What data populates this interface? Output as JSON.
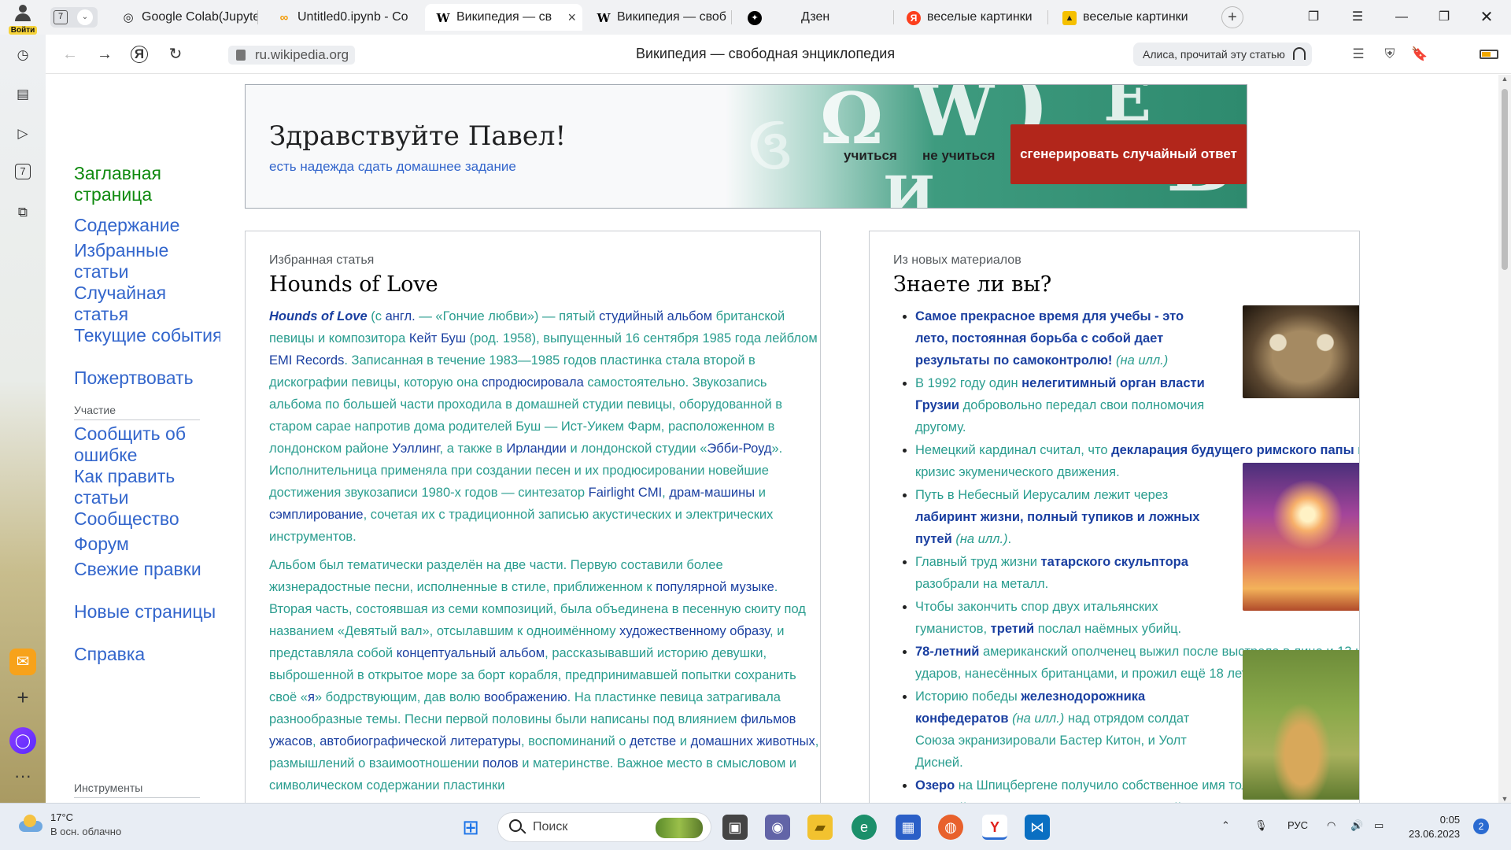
{
  "tabbar": {
    "profile_label": "Войти",
    "tab_count": "7",
    "tabs": [
      {
        "title": "Google Colab(Jupyter",
        "icon": "◎"
      },
      {
        "title": "Untitled0.ipynb - Co",
        "icon": "∞"
      },
      {
        "title": "Википедия — св",
        "icon": "W"
      },
      {
        "title": "Википедия — своб",
        "icon": "W"
      },
      {
        "title": "Дзен",
        "icon": "✦"
      },
      {
        "title": "веселые картинки",
        "icon": "Я"
      },
      {
        "title": "веселые картинки",
        "icon": "▲"
      }
    ],
    "active_close": "×"
  },
  "addressbar": {
    "url": "ru.wikipedia.org",
    "page_title": "Википедия — свободная энциклопедия",
    "alice_label": "Алиса, прочитай эту статью"
  },
  "wiki_nav": {
    "main_page": "Заглавная страница",
    "links": [
      "Содержание",
      "Избранные статьи",
      "Случайная статья",
      "Текущие события",
      "Пожертвовать"
    ],
    "participation_heading": "Участие",
    "participation_links": [
      "Сообщить об ошибке",
      "Как править статьи",
      "Сообщество",
      "Форум",
      "Свежие правки",
      "Новые страницы",
      "Справка"
    ],
    "tools_heading": "Инструменты"
  },
  "banner": {
    "greeting": "Здравствуйте Павел!",
    "subtitle": "есть надежда сдать домашнее задание",
    "btn_study": "учиться",
    "btn_nostudy": "не учиться",
    "btn_generate": "сгенерировать случайный ответ"
  },
  "featured": {
    "label": "Избранная статья",
    "title": "Hounds of Love",
    "p1": [
      {
        "t": "Hounds of Love",
        "s": "bi"
      },
      {
        "t": " (с ",
        "s": ""
      },
      {
        "t": "англ.",
        "s": "l"
      },
      {
        "t": " — «Гончие любви») — пятый ",
        "s": ""
      },
      {
        "t": "студийный альбом",
        "s": "l"
      },
      {
        "t": " британской певицы и композитора ",
        "s": ""
      },
      {
        "t": "Кейт Буш",
        "s": "l"
      },
      {
        "t": " (род. 1958), выпущенный 16 сентября 1985 года лейблом ",
        "s": ""
      },
      {
        "t": "EMI Records",
        "s": "l"
      },
      {
        "t": ". Записанная в течение 1983—1985 годов пластинка стала второй в дискографии певицы, которую она ",
        "s": ""
      },
      {
        "t": "спродюсировала",
        "s": "l"
      },
      {
        "t": " самостоятельно. Звукозапись альбома по большей части проходила в домашней студии певицы, оборудованной в старом сарае напротив дома родителей Буш — Ист-Уикем Фарм, расположенном в лондонском районе ",
        "s": ""
      },
      {
        "t": "Уэллинг",
        "s": "l"
      },
      {
        "t": ", а также в ",
        "s": ""
      },
      {
        "t": "Ирландии",
        "s": "l"
      },
      {
        "t": " и лондонской студии «",
        "s": ""
      },
      {
        "t": "Эбби-Роуд",
        "s": "l"
      },
      {
        "t": "». Исполнительница применяла при создании песен и их продюсировании новейшие достижения звукозаписи 1980-х годов — синтезатор ",
        "s": ""
      },
      {
        "t": "Fairlight CMI",
        "s": "l"
      },
      {
        "t": ", ",
        "s": ""
      },
      {
        "t": "драм-машины",
        "s": "l"
      },
      {
        "t": " и ",
        "s": ""
      },
      {
        "t": "сэмплирование",
        "s": "l"
      },
      {
        "t": ", сочетая их с традиционной записью акустических и электрических инструментов.",
        "s": ""
      }
    ],
    "p2": [
      {
        "t": "Альбом был тематически разделён на две части. Первую составили более жизнерадостные песни, исполненные в стиле, приближенном к ",
        "s": ""
      },
      {
        "t": "популярной музыке",
        "s": "l"
      },
      {
        "t": ". Вторая часть, состоявшая из семи композиций, была объединена в песенную сюиту под названием «Девятый вал», отсылавшим к одноимённому ",
        "s": ""
      },
      {
        "t": "художественному образу",
        "s": "l"
      },
      {
        "t": ", и представляла собой ",
        "s": ""
      },
      {
        "t": "концептуальный альбом",
        "s": "l"
      },
      {
        "t": ", рассказывавший историю девушки, выброшенной в открытое море за борт корабля, предпринимавшей попытки сохранить своё «",
        "s": ""
      },
      {
        "t": "я",
        "s": "l"
      },
      {
        "t": "» бодрствующим, дав волю ",
        "s": ""
      },
      {
        "t": "воображению",
        "s": "l"
      },
      {
        "t": ". На пластинке певица затрагивала разнообразные темы. Песни первой половины были написаны под влиянием ",
        "s": ""
      },
      {
        "t": "фильмов ужасов",
        "s": "l"
      },
      {
        "t": ", ",
        "s": ""
      },
      {
        "t": "автобиографической литературы",
        "s": "l"
      },
      {
        "t": ", воспоминаний о ",
        "s": ""
      },
      {
        "t": "детстве",
        "s": "l"
      },
      {
        "t": " и ",
        "s": ""
      },
      {
        "t": "домашних животных",
        "s": "l"
      },
      {
        "t": ", размышлений о взаимоотношении ",
        "s": ""
      },
      {
        "t": "полов",
        "s": "l"
      },
      {
        "t": " и материнстве. Важное место в смысловом и символическом содержании пластинки",
        "s": ""
      }
    ]
  },
  "dyk": {
    "label": "Из новых материалов",
    "title": "Знаете ли вы?",
    "items": [
      [
        {
          "t": "Самое прекрасное время для учебы - это лето, постоянная борьба с собой дает результаты по самоконтролю!",
          "s": "b"
        },
        {
          "t": " (на илл.)",
          "s": "i"
        }
      ],
      [
        {
          "t": "В 1992 году один ",
          "s": ""
        },
        {
          "t": "нелегитимный орган власти Грузии",
          "s": "b"
        },
        {
          "t": " добровольно передал свои полномочия другому.",
          "s": ""
        }
      ],
      [
        {
          "t": "Немецкий кардинал считал, что ",
          "s": ""
        },
        {
          "t": "декларация будущего римского папы",
          "s": "b"
        },
        {
          "t": " вызвала кризис ",
          "s": ""
        },
        {
          "t": "экуменического движения",
          "s": "l"
        },
        {
          "t": ".",
          "s": ""
        }
      ],
      [
        {
          "t": "Путь в Небесный Иерусалим лежит через ",
          "s": ""
        },
        {
          "t": "лабиринт жизни, полный тупиков и ложных путей",
          "s": "b"
        },
        {
          "t": " (на илл.)",
          "s": "i"
        },
        {
          "t": ".",
          "s": ""
        }
      ],
      [
        {
          "t": "Главный труд жизни ",
          "s": ""
        },
        {
          "t": "татарского скульптора",
          "s": "b"
        },
        {
          "t": " разобрали на металл.",
          "s": ""
        }
      ],
      [
        {
          "t": "Чтобы закончить спор двух ",
          "s": ""
        },
        {
          "t": "итальянских гуманистов",
          "s": "l"
        },
        {
          "t": ", ",
          "s": ""
        },
        {
          "t": "третий",
          "s": "b"
        },
        {
          "t": " послал наёмных убийц.",
          "s": ""
        }
      ],
      [
        {
          "t": "78-летний",
          "s": "b"
        },
        {
          "t": " американский ополченец выжил после выстрела в лицо и 13 штыковых ударов, нанесённых ",
          "s": ""
        },
        {
          "t": "британцами",
          "s": "l"
        },
        {
          "t": ", и прожил ещё 18 лет.",
          "s": ""
        }
      ],
      [
        {
          "t": "Историю победы ",
          "s": ""
        },
        {
          "t": "железнодорожника конфедератов",
          "s": "b"
        },
        {
          "t": " (на илл.)",
          "s": "i"
        },
        {
          "t": " над отрядом солдат Союза экранизировали Бастер Китон, и Уолт Дисней.",
          "s": ""
        }
      ],
      [
        {
          "t": "Озеро",
          "s": "b"
        },
        {
          "t": " на ",
          "s": ""
        },
        {
          "t": "Шпицбергене",
          "s": "l"
        },
        {
          "t": " получило собственное имя только в 2014 году.",
          "s": ""
        }
      ],
      [
        {
          "t": "Римский классик из двух греческих комедий создал ",
          "s": ""
        },
        {
          "t": "одну латинскую",
          "s": "b"
        },
        {
          "t": ".",
          "s": ""
        }
      ]
    ]
  },
  "taskbar": {
    "temp": "17°C",
    "weather": "В осн. облачно",
    "search_placeholder": "Поиск",
    "lang": "РУС",
    "time": "0:05",
    "date": "23.06.2023",
    "notifications": "2"
  }
}
